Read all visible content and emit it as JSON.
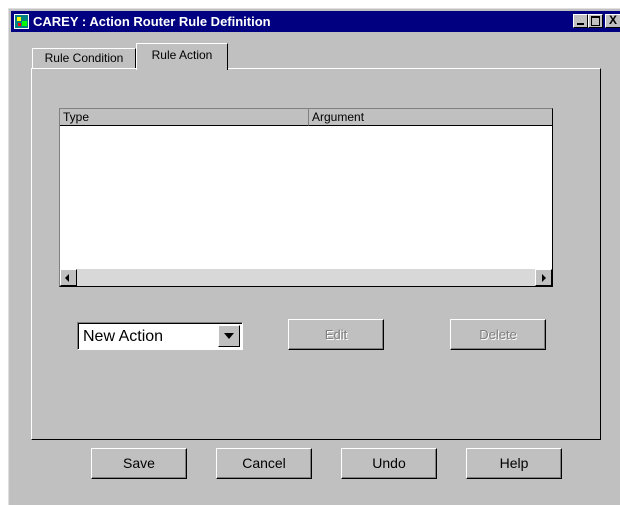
{
  "window": {
    "title": "CAREY : Action Router Rule Definition",
    "close_glyph": "X"
  },
  "tabs": [
    {
      "label": "Rule Condition",
      "selected": false
    },
    {
      "label": "Rule Action",
      "selected": true
    }
  ],
  "action_table": {
    "columns": [
      "Type",
      "Argument"
    ],
    "rows": []
  },
  "action_controls": {
    "action_select_value": "New Action",
    "edit_label": "Edit",
    "edit_enabled": false,
    "delete_label": "Delete",
    "delete_enabled": false
  },
  "footer": {
    "save_label": "Save",
    "cancel_label": "Cancel",
    "undo_label": "Undo",
    "help_label": "Help"
  }
}
